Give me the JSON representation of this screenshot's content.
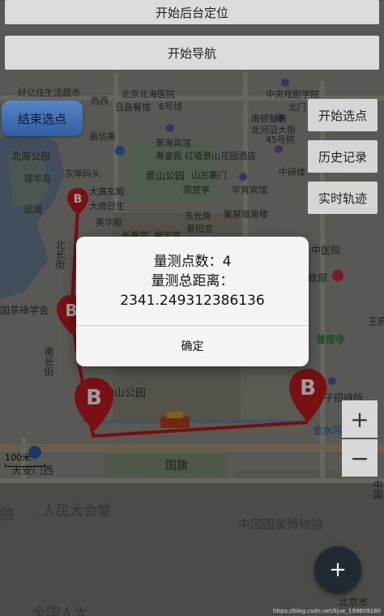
{
  "top_buttons": {
    "start_background_location": "开始后台定位",
    "start_navigation": "开始导航"
  },
  "end_select_button": "结束选点",
  "side_buttons": {
    "start_select": "开始选点",
    "history": "历史记录",
    "realtime_track": "实时轨迹"
  },
  "zoom": {
    "in": "+",
    "out": "−"
  },
  "fab": "+",
  "map_labels": {
    "l1": "好亿佳生活超市",
    "l2": "北京北海医院",
    "l3": "中央戏剧学院",
    "l4": "西西",
    "l5": "日昌餐馆",
    "l6": "6号线",
    "l7": "北门",
    "l8": "画坊斋",
    "l9": "景海宾馆",
    "l10": "南锣鼓巷",
    "l11": "北海公园",
    "l12": "北河沿大街",
    "l13": "45号院",
    "l14": "寿皇殿",
    "l15": "红墙景山花园酒店",
    "l16": "东岸码头",
    "l17": "景山公园",
    "l18": "山左裹门",
    "l19": "琼华岛",
    "l20": "周赏亭",
    "l21": "华育宾馆",
    "l22": "中研楼",
    "l23": "团城",
    "l24": "大高玄殿",
    "l25": "大德日生",
    "l26": "东长房",
    "l27": "紫禁城角楼",
    "l28": "英华殿",
    "l29": "景阳宫",
    "l30": "北长街",
    "l31": "长春宫",
    "l32": "坤宁宫",
    "l33": "中医院",
    "l34": "国茶禅学会",
    "l35": "政部",
    "l36": "南长街",
    "l37": "普度寺",
    "l38": "王府",
    "l39": "中山公园",
    "l40": "子招待所",
    "l41": "金水河",
    "l42": "天安门西",
    "l43": "国旗",
    "l44": "人民大会堂",
    "l45": "中国国家博物馆",
    "l46": "北京市",
    "l47": "院",
    "l48": "全国人大",
    "l49": "中国"
  },
  "scale": "100米",
  "dialog": {
    "line1": "量测点数：4",
    "line2": "量测总距离：",
    "line3": "2341.249312386136",
    "ok": "确定"
  },
  "marker_letter": "B",
  "watermark": "https://blog.csdn.net/lijue_199609180",
  "colors": {
    "route": "#c0161c",
    "marker": "#c41a1f",
    "fab": "#1f2a33"
  }
}
